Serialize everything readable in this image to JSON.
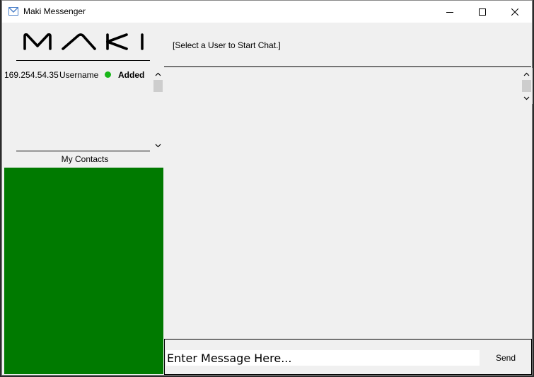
{
  "window": {
    "title": "Maki Messenger"
  },
  "logo": {
    "text": "MAKI"
  },
  "contacts": [
    {
      "ip": "169.254.54.35",
      "username": "Username",
      "status": "Added",
      "status_color": "#19b719"
    }
  ],
  "sidebar": {
    "contacts_label": "My Contacts",
    "panel_color": "#007a00"
  },
  "chat": {
    "header": "[Select a User to Start Chat.]"
  },
  "composer": {
    "message_value": "Enter Message Here...",
    "send_label": "Send"
  }
}
